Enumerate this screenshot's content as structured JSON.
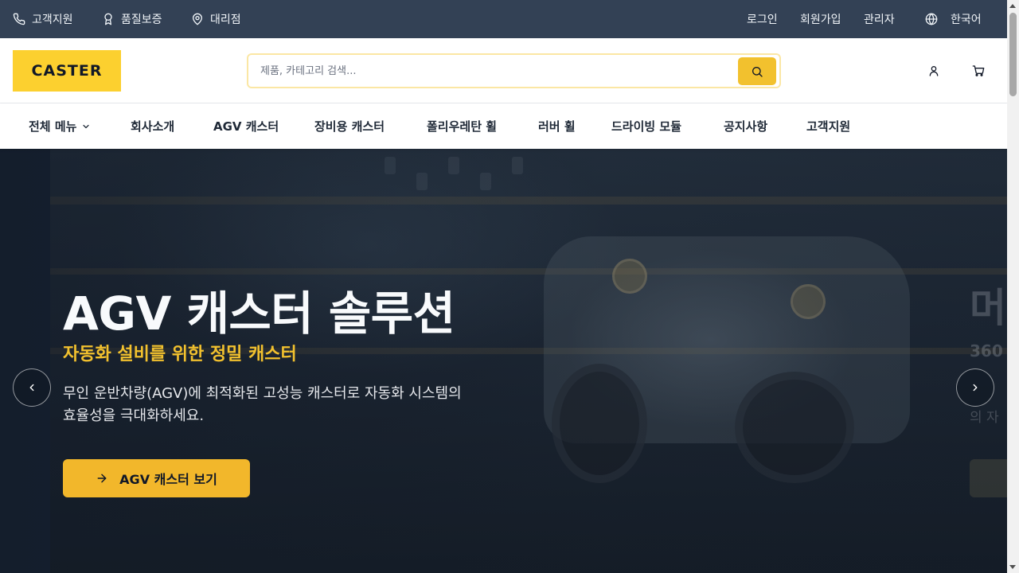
{
  "topbar": {
    "left": [
      {
        "label": "고객지원",
        "icon": "phone-icon"
      },
      {
        "label": "품질보증",
        "icon": "award-icon"
      },
      {
        "label": "대리점",
        "icon": "map-pin-icon"
      }
    ],
    "login": "로그인",
    "signup": "회원가입",
    "admin": "관리자",
    "language": "한국어"
  },
  "header": {
    "logo": "CASTER",
    "search_placeholder": "제품, 카테고리 검색..."
  },
  "nav": {
    "all_menu": "전체 메뉴",
    "items": [
      "회사소개",
      "AGV 캐스터",
      "장비용 캐스터",
      "폴리우레탄 휠",
      "러버 휠",
      "드라이빙 모듈",
      "공지사항",
      "고객지원"
    ]
  },
  "hero": {
    "title": "AGV 캐스터 솔루션",
    "subtitle": "자동화 설비를 위한 정밀 캐스터",
    "description": "무인 운반차량(AGV)에 최적화된 고성능 캐스터로 자동화 시스템의 효율성을 극대화하세요.",
    "cta": "AGV 캐스터 보기",
    "next_title_partial": "머",
    "next_sub_partial": "360",
    "next_desc_partial": "의 자"
  },
  "colors": {
    "topbar_bg": "#334155",
    "brand_yellow": "#fcd02f",
    "accent": "#f2b72b",
    "hero_bg": "#1a2433"
  }
}
